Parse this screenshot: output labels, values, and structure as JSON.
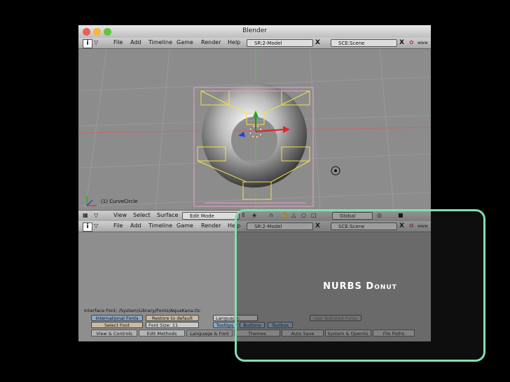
{
  "window": {
    "title": "Blender",
    "traffic_light_colors": [
      "#ee5d52",
      "#f5b63c",
      "#5fc63f"
    ]
  },
  "header_top": {
    "menus": [
      "File",
      "Add",
      "Timeline",
      "Game",
      "Render",
      "Help"
    ],
    "screen_field": "SR:2-Model",
    "scene_field": "SCE:Scene",
    "close_label": "X",
    "info_label": "i",
    "right_label": "www"
  },
  "viewport": {
    "object_label": "(1) CurveCircle"
  },
  "header_3d": {
    "menus": [
      "View",
      "Select",
      "Surface"
    ],
    "mode": "Edit Mode",
    "orientation": "Global"
  },
  "header_bottom": {
    "menus": [
      "File",
      "Add",
      "Timeline",
      "Game",
      "Render",
      "Help"
    ],
    "screen_field": "SR:2-Model",
    "scene_field": "SCE:Scene",
    "close_label": "X",
    "info_label": "i",
    "right_label": "www"
  },
  "prefs": {
    "font_path": "Interface Font: /System/Library/Fonts/AquaKana.ttc",
    "intl_fonts": "International Fonts",
    "restore_default": "Restore to default",
    "language": "Language: Japanese",
    "select_font": "Select Font",
    "font_size": "Font Size:  11",
    "tooltips": "Tooltips",
    "buttons": "Buttons",
    "toolbox": "Toolbox",
    "textured_fonts": "Use Textured Fonts",
    "tabs": [
      "View & Controls",
      "Edit Methods",
      "Language & Font",
      "Themes",
      "Auto Save",
      "System & OpenGL",
      "File Paths"
    ]
  },
  "overlay": {
    "caption": "NURBS Donut",
    "border_color": "#7fe0b4"
  }
}
